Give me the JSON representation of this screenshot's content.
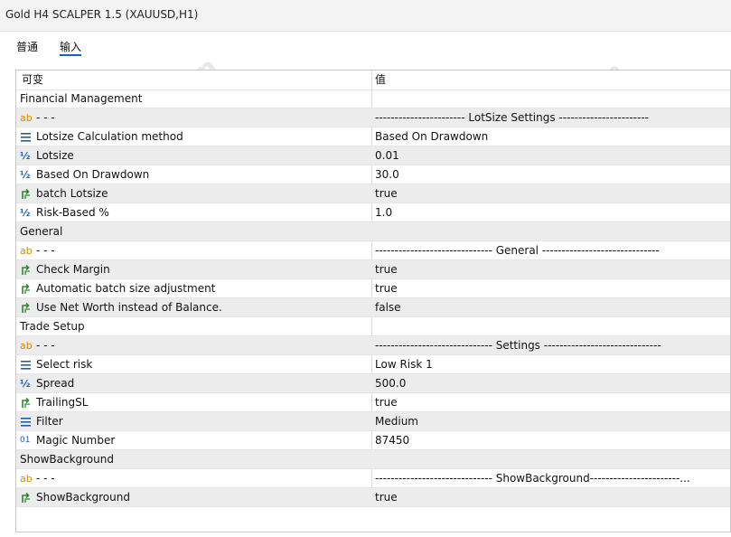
{
  "window": {
    "title": "Gold H4 SCALPER 1.5 (XAUUSD,H1)"
  },
  "tabs": [
    {
      "label": "普通"
    },
    {
      "label": "输入"
    }
  ],
  "table": {
    "headers": {
      "variable": "可变",
      "value": "值"
    },
    "rows": [
      {
        "type": "group",
        "name": "Financial Management",
        "value": ""
      },
      {
        "type": "string",
        "icon": "ab-icon",
        "name": "- - -",
        "value": "----------------------- LotSize Settings -----------------------"
      },
      {
        "type": "enum",
        "icon": "list-icon",
        "name": "Lotsize Calculation method",
        "value": "Based On Drawdown"
      },
      {
        "type": "double",
        "icon": "half-icon",
        "name": "Lotsize",
        "value": "0.01"
      },
      {
        "type": "double",
        "icon": "half-icon",
        "name": "Based On Drawdown",
        "value": "30.0"
      },
      {
        "type": "bool",
        "icon": "bool-arrow-icon",
        "name": "batch Lotsize",
        "value": "true"
      },
      {
        "type": "double",
        "icon": "half-icon",
        "name": "Risk-Based %",
        "value": "1.0"
      },
      {
        "type": "group",
        "name": "General",
        "value": ""
      },
      {
        "type": "string",
        "icon": "ab-icon",
        "name": "- - -",
        "value": "------------------------------ General ------------------------------"
      },
      {
        "type": "bool",
        "icon": "bool-arrow-icon",
        "name": "Check Margin",
        "value": "true"
      },
      {
        "type": "bool",
        "icon": "bool-arrow-icon",
        "name": "Automatic batch size adjustment",
        "value": "true"
      },
      {
        "type": "bool",
        "icon": "bool-arrow-icon",
        "name": "Use Net Worth instead of Balance.",
        "value": "false"
      },
      {
        "type": "group",
        "name": "Trade Setup",
        "value": ""
      },
      {
        "type": "string",
        "icon": "ab-icon",
        "name": "- - -",
        "value": "------------------------------ Settings ------------------------------"
      },
      {
        "type": "enum",
        "icon": "list-icon",
        "name": "Select risk",
        "value": "Low Risk 1"
      },
      {
        "type": "double",
        "icon": "half-icon",
        "name": "Spread",
        "value": "500.0"
      },
      {
        "type": "bool",
        "icon": "bool-arrow-icon",
        "name": "TrailingSL",
        "value": "true"
      },
      {
        "type": "enum",
        "icon": "list-icon",
        "name": "Filter",
        "value": "Medium"
      },
      {
        "type": "int",
        "icon": "int-icon",
        "name": "Magic Number",
        "value": "87450"
      },
      {
        "type": "group",
        "name": "ShowBackground",
        "value": ""
      },
      {
        "type": "string",
        "icon": "ab-icon",
        "name": "- - -",
        "value": "------------------------------ ShowBackground-----------------------..."
      },
      {
        "type": "bool",
        "icon": "bool-arrow-icon",
        "name": "ShowBackground",
        "value": "true"
      }
    ]
  },
  "watermark": {
    "text": "EAHub.cn"
  },
  "colors": {
    "tab_underline": "#1f5fbf",
    "alt_row": "#ececec",
    "ab_icon": "#d48b00",
    "type_icon": "#1a5fb4",
    "bool_icon": "#2e8b2e"
  }
}
